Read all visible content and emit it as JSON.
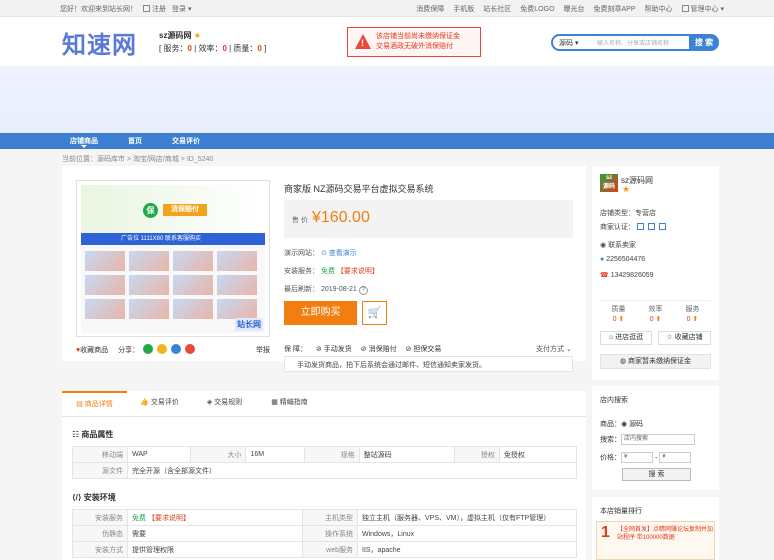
{
  "topbar": {
    "welcome": "您好！欢迎来到站长网！",
    "register": "注册",
    "login": "登录",
    "links": [
      "消费保障",
      "手机版",
      "站长社区",
      "免费LOGO",
      "曝光台",
      "免费刻章APP",
      "帮助中心",
      "管理中心"
    ]
  },
  "header": {
    "logo": "知速网",
    "shop_name": "sz源码网",
    "score_labels": [
      "服务",
      "效率",
      "质量"
    ],
    "score_values": [
      "0",
      "0",
      "0"
    ],
    "warning_line1": "该店铺当前尚未缴纳保证金",
    "warning_line2": "交易酒政无破外消保赔付",
    "search_select": "源码",
    "search_placeholder": "输入名称、分享或店铺名称",
    "search_button": "搜 索"
  },
  "nav": {
    "items": [
      "店铺商品",
      "首页",
      "交易评价"
    ]
  },
  "breadcrumb": "当前位置：源码库市 > 淘宝/网店/商城 > ID_5240",
  "gallery": {
    "banner_text": "消保赔付",
    "blue_text": "广告位  1111X80  联系客服购买",
    "brand": "站长网"
  },
  "product": {
    "title": "商家版 NZ源码交易平台虚拟交易系统",
    "price_label": "售 价",
    "price": "¥160.00",
    "demo_label": "演示网站：",
    "demo_link": "查看演示",
    "install_label": "安装服务：",
    "install_free": "免费",
    "install_note": "【要求说明】",
    "update_label": "最后刷新：",
    "update_date": "2019-08-21",
    "buy": "立即购买",
    "collect": "收藏商品",
    "share": "分享：",
    "report": "举报",
    "guarantee_label": "保 障：",
    "guarantees": [
      "手动发货",
      "消保赔付",
      "担保交易"
    ],
    "pay_method": "支付方式",
    "note": "手动发货商品，拍下后系统会通过邮件、短信通知卖家发货。"
  },
  "tabs": [
    "商品详情",
    "交易评价",
    "交易规则",
    "精编指南"
  ],
  "attributes": {
    "title": "商品属性",
    "rows": [
      [
        "移动端",
        "WAP",
        "大小",
        "16M",
        "规格",
        "整站源码",
        "授权",
        "免授权"
      ],
      [
        "源文件",
        "完全开源（含全部源文件）"
      ]
    ]
  },
  "environment": {
    "title": "安装环境",
    "rows": [
      [
        "安装服务",
        "免费",
        "【要求说明】",
        "主机类型",
        "独立主机（服务器、VPS、VM），虚拟主机（仅有FTP管理）"
      ],
      [
        "伪静态",
        "需要",
        "",
        "操作系统",
        "Windows，Linux"
      ],
      [
        "安装方式",
        "提供管理权限",
        "",
        "web服务",
        "IIS，apache"
      ]
    ]
  },
  "sidebar": {
    "shop_name": "sz源码网",
    "shop_type_label": "店铺类型：",
    "shop_type": "专营店",
    "cert_label": "商家认证：",
    "contact": "联系卖家",
    "qq": "2256504476",
    "phone": "13429826059",
    "score_labels": [
      "质量",
      "效率",
      "服务"
    ],
    "score_values": [
      "0",
      "0",
      "0"
    ],
    "enter_shop": "进店逛逛",
    "collect_shop": "收藏店铺",
    "no_deposit": "商家暂未缴纳保证金",
    "search_title": "店内搜索",
    "product_label": "商品：",
    "product_radio": "源码",
    "keyword_label": "搜索：",
    "keyword_placeholder": "店内搜索",
    "price_label": "价格：",
    "price_min": "¥",
    "price_max": "¥",
    "search_button": "搜 索",
    "ranking_title": "本店销量排行",
    "ad_rank": "1",
    "ad_text": "【全网首发】点睛网赚论坛复制并加站程序 带100000数据"
  }
}
